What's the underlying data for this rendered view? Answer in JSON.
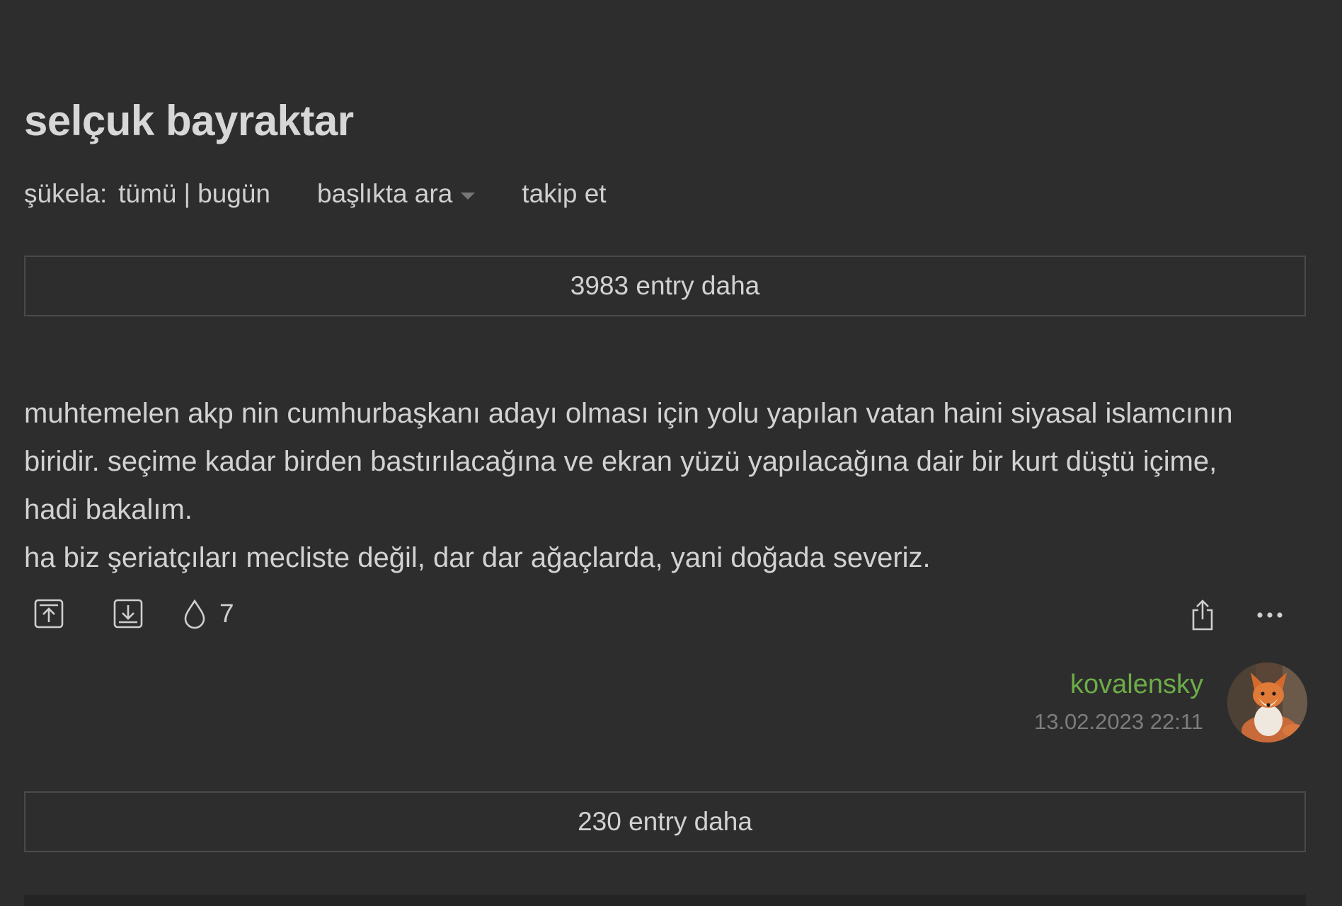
{
  "topic": {
    "title": "selçuk bayraktar"
  },
  "nav": {
    "sukela_label": "şükela:",
    "all_label": "tümü",
    "separator": "|",
    "today_label": "bugün",
    "search_label": "başlıkta ara",
    "follow_label": "takip et"
  },
  "load_more_top": "3983 entry daha",
  "load_more_bottom": "230 entry daha",
  "entry": {
    "lines": [
      "muhtemelen akp nin cumhurbaşkanı adayı olması için yolu yapılan vatan haini siyasal islamcının",
      "biridir. seçime kadar birden bastırılacağına ve ekran yüzü yapılacağına dair bir kurt düştü içime,",
      "hadi bakalım.",
      "ha biz şeriatçıları mecliste değil, dar dar ağaçlarda, yani doğada severiz."
    ],
    "favorite_count": "7",
    "author": "kovalensky",
    "date": "13.02.2023 22:11"
  },
  "icons": {
    "upvote": "upvote-icon",
    "downvote": "downvote-icon",
    "favorite": "drop-icon",
    "share": "share-icon",
    "more": "more-dots-icon",
    "avatar": "fox-avatar"
  },
  "colors": {
    "background": "#2d2d2d",
    "text": "#d2d2d2",
    "author": "#6dad48",
    "date": "#7d7d7d",
    "border": "#4a4a4a"
  }
}
